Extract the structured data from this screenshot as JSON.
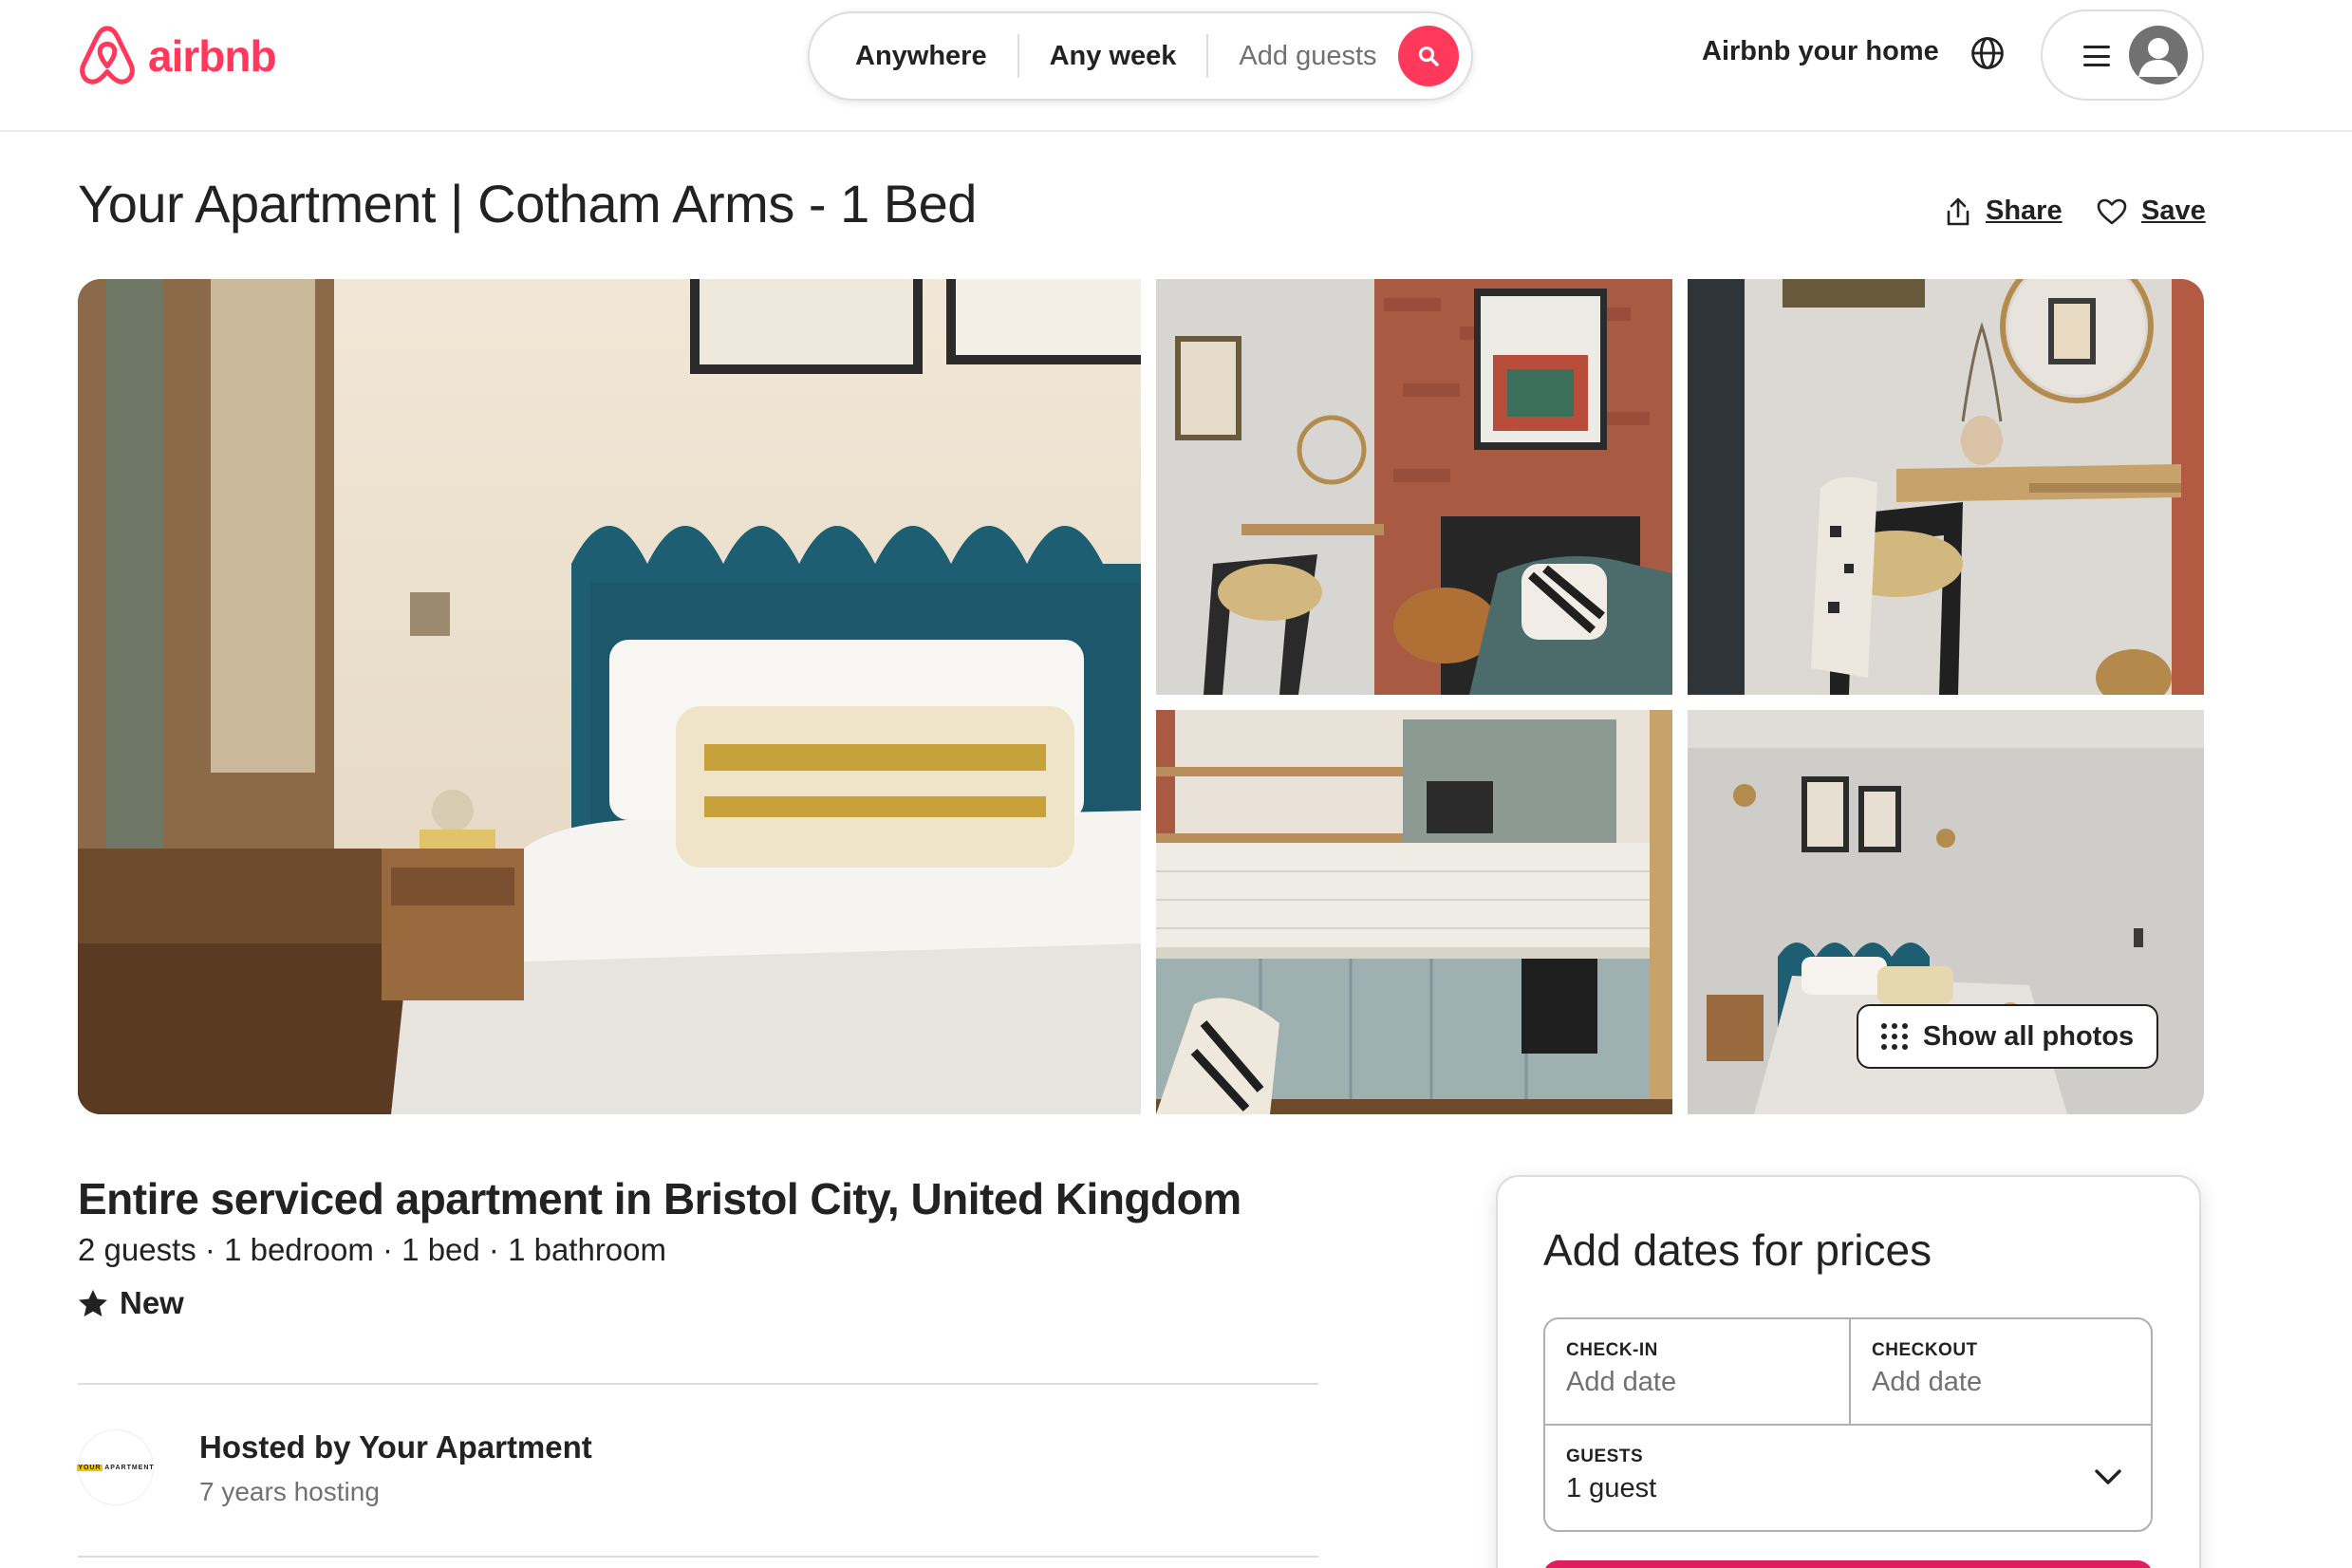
{
  "header": {
    "logo_text": "airbnb",
    "search": {
      "where": "Anywhere",
      "when": "Any week",
      "guests_placeholder": "Add guests"
    },
    "host_link": "Airbnb your home",
    "icons": [
      "airbnb-logo-icon",
      "search-icon",
      "globe-icon",
      "menu-icon",
      "user-avatar-icon"
    ],
    "brand_color": "#ff385c"
  },
  "listing": {
    "title": "Your Apartment | Cotham Arms - 1 Bed",
    "actions": {
      "share": "Share",
      "save": "Save"
    },
    "photos": {
      "show_all": "Show all photos",
      "items": [
        "bedroom-with-teal-headboard",
        "desk-by-brick-fireplace",
        "desk-with-round-mirror",
        "kitchen",
        "bedroom-overview"
      ]
    },
    "type_location": "Entire serviced apartment in Bristol City, United Kingdom",
    "details": "2 guests · 1 bedroom · 1 bed · 1 bathroom",
    "rating_label": "New",
    "host": {
      "name": "Hosted by Your Apartment",
      "experience": "7 years hosting",
      "avatar_text_1": "YOUR",
      "avatar_text_2": "APARTMENT"
    }
  },
  "booking": {
    "title": "Add dates for prices",
    "checkin_label": "CHECK-IN",
    "checkin_value": "Add date",
    "checkout_label": "CHECKOUT",
    "checkout_value": "Add date",
    "guests_label": "GUESTS",
    "guests_value": "1 guest",
    "reserve_color": "#e31c5f"
  }
}
